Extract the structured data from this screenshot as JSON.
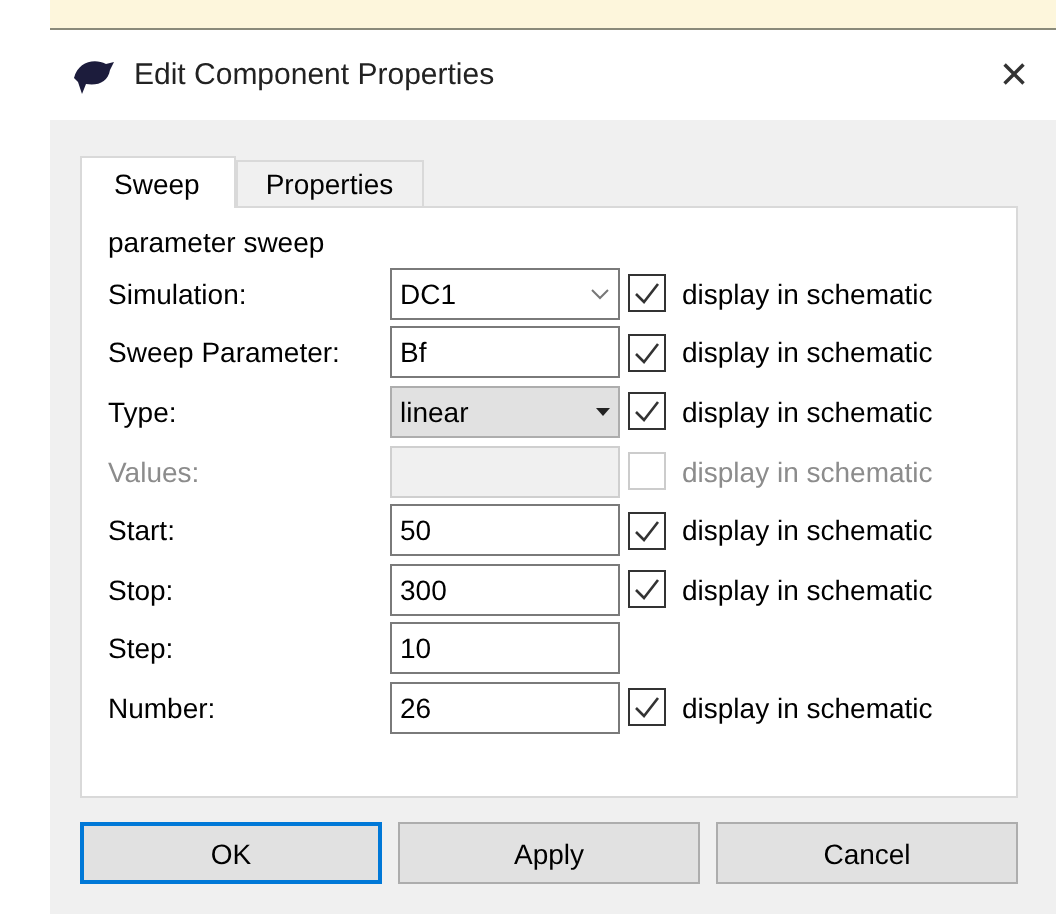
{
  "window": {
    "title": "Edit Component Properties",
    "close": "×"
  },
  "tabs": [
    {
      "label": "Sweep",
      "selected": true
    },
    {
      "label": "Properties",
      "selected": false
    }
  ],
  "group_label": "parameter sweep",
  "rows": [
    {
      "label": "Simulation:",
      "kind": "combo",
      "value": "DC1",
      "disabled": false,
      "option": {
        "label": "display in schematic",
        "checked": true
      }
    },
    {
      "label": "Sweep Parameter:",
      "kind": "text",
      "value": "Bf",
      "disabled": false,
      "option": {
        "label": "display in schematic",
        "checked": true
      }
    },
    {
      "label": "Type:",
      "kind": "dropdown",
      "value": "linear",
      "disabled": false,
      "option": {
        "label": "display in schematic",
        "checked": true
      }
    },
    {
      "label": "Values:",
      "kind": "text",
      "value": "",
      "disabled": true,
      "option": {
        "label": "display in schematic",
        "checked": false
      }
    },
    {
      "label": "Start:",
      "kind": "text",
      "value": "50",
      "disabled": false,
      "option": {
        "label": "display in schematic",
        "checked": true
      }
    },
    {
      "label": "Stop:",
      "kind": "text",
      "value": "300",
      "disabled": false,
      "option": {
        "label": "display in schematic",
        "checked": true
      }
    },
    {
      "label": "Step:",
      "kind": "text",
      "value": "10",
      "disabled": false
    },
    {
      "label": "Number:",
      "kind": "text",
      "value": "26",
      "disabled": false,
      "option": {
        "label": "display in schematic",
        "checked": true
      }
    }
  ],
  "buttons": [
    {
      "label": "OK",
      "selected": true
    },
    {
      "label": "Apply",
      "selected": false
    },
    {
      "label": "Cancel",
      "selected": false
    }
  ]
}
